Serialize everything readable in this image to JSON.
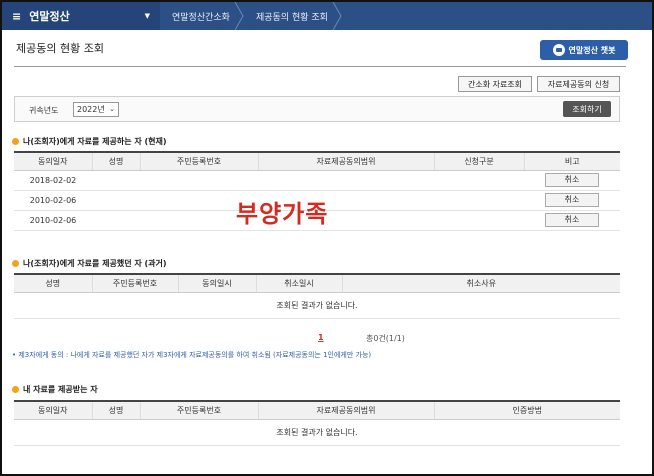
{
  "nav": {
    "menu_title": "연말정산",
    "menu_icon": "menu-icon",
    "crumbs": [
      "연말정산간소화",
      "제공동의 현황 조회"
    ]
  },
  "page": {
    "title": "제공동의 현황 조회",
    "chatbot_label": "연말정산 챗봇",
    "btn_simple_data": "간소화 자료조회",
    "btn_consent_request": "자료제공동의 신청"
  },
  "filter": {
    "label": "귀속년도",
    "year_value": "2022년",
    "search_label": "조회하기"
  },
  "section1": {
    "title": "나(조회자)에게 자료를 제공하는 자 (현재)",
    "columns": [
      "동의일자",
      "성명",
      "주민등록번호",
      "자료제공동의범위",
      "신청구분",
      "비고"
    ],
    "rows": [
      {
        "date": "2018-02-02",
        "action": "취소"
      },
      {
        "date": "2010-02-06",
        "action": "취소"
      },
      {
        "date": "2010-02-06",
        "action": "취소"
      }
    ],
    "overlay": "부양가족"
  },
  "section2": {
    "title": "나(조회자)에게 자료를 제공했던 자 (과거)",
    "columns": [
      "성명",
      "주민등록번호",
      "동의일시",
      "취소일시",
      "취소사유"
    ],
    "empty": "조회된 결과가 없습니다.",
    "page_current": "1",
    "page_total": "총0건(1/1)",
    "note": "• 제3자에게 동의 : 나에게 자료를 제공했던 자가 제3자에게 자료제공동의를 하여 취소됨 (자료제공동의는 1인에게만 가능)"
  },
  "section3": {
    "title": "내 자료를 제공받는 자",
    "columns": [
      "동의일자",
      "성명",
      "주민등록번호",
      "자료제공동의범위",
      "인증방법"
    ],
    "empty": "조회된 결과가 없습니다."
  }
}
